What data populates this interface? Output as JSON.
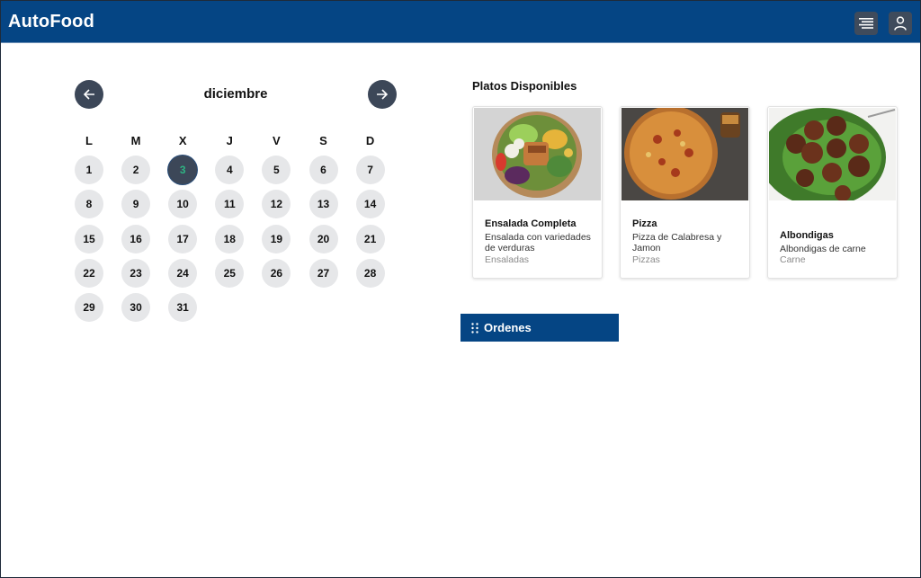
{
  "app": {
    "title": "AutoFood"
  },
  "header": {
    "menu_icon": "menu-lines-icon",
    "user_icon": "user-icon"
  },
  "calendar": {
    "month": "diciembre",
    "prev_icon": "arrow-left-icon",
    "next_icon": "arrow-right-icon",
    "weekdays": [
      "L",
      "M",
      "X",
      "J",
      "V",
      "S",
      "D"
    ],
    "days": [
      "1",
      "2",
      "3",
      "4",
      "5",
      "6",
      "7",
      "8",
      "9",
      "10",
      "11",
      "12",
      "13",
      "14",
      "15",
      "16",
      "17",
      "18",
      "19",
      "20",
      "21",
      "22",
      "23",
      "24",
      "25",
      "26",
      "27",
      "28",
      "29",
      "30",
      "31"
    ],
    "selected_day": "3",
    "colors": {
      "day_bg": "#e6e7e9",
      "selected_bg": "#3c4758",
      "selected_text": "#2fb483"
    }
  },
  "platos": {
    "title": "Platos Disponibles",
    "items": [
      {
        "name": "Ensalada Completa",
        "description": "Ensalada con variedades de verduras",
        "category": "Ensaladas"
      },
      {
        "name": "Pizza",
        "description": "Pizza de Calabresa y Jamon",
        "category": "Pizzas"
      },
      {
        "name": "Albondigas",
        "description": "Albondigas de carne",
        "category": "Carne"
      }
    ]
  },
  "ordenes": {
    "label": "Ordenes",
    "icon": "drag-grip-icon"
  },
  "theme": {
    "primary": "#054584",
    "dark": "#3c4758"
  }
}
